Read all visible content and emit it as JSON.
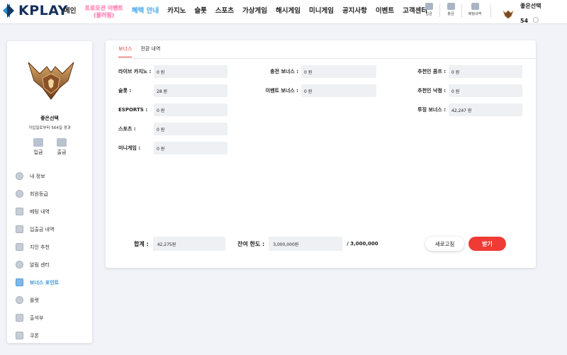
{
  "brand": {
    "name": "KPLAY"
  },
  "nav": {
    "items": [
      {
        "label": "메인",
        "style": "normal"
      },
      {
        "label": "프로모션 이벤트",
        "sub": "(블러됨)",
        "style": "pink"
      },
      {
        "label": "혜택 안내",
        "style": "blue"
      },
      {
        "label": "카지노",
        "style": "normal"
      },
      {
        "label": "슬롯",
        "style": "normal"
      },
      {
        "label": "스포츠",
        "style": "normal"
      },
      {
        "label": "가상게임",
        "style": "normal"
      },
      {
        "label": "해시게임",
        "style": "normal"
      },
      {
        "label": "미니게임",
        "style": "normal"
      },
      {
        "label": "공지사항",
        "style": "normal"
      },
      {
        "label": "이벤트",
        "style": "normal"
      },
      {
        "label": "고객센터",
        "style": "normal"
      }
    ],
    "quick": [
      {
        "label": "입금",
        "icon": "deposit-icon"
      },
      {
        "label": "출금",
        "icon": "withdraw-icon"
      },
      {
        "label": "배팅내역",
        "icon": "history-icon"
      }
    ]
  },
  "user": {
    "name": "좋은선택",
    "level": "54",
    "since": "가입일로부터 564일 경과",
    "deposit_label": "입금",
    "withdraw_label": "출금"
  },
  "sidebar": {
    "items": [
      {
        "label": "내 정보",
        "icon": "user-icon",
        "active": false
      },
      {
        "label": "회원등급",
        "icon": "grade-icon",
        "active": false
      },
      {
        "label": "베팅 내역",
        "icon": "betting-history-icon",
        "active": false
      },
      {
        "label": "입출금 내역",
        "icon": "transaction-icon",
        "active": false
      },
      {
        "label": "지인 추천",
        "icon": "referral-icon",
        "active": false
      },
      {
        "label": "알림 센터",
        "icon": "bell-icon",
        "active": false
      },
      {
        "label": "보너스 포인트",
        "icon": "bonus-icon",
        "active": true
      },
      {
        "label": "룰렛",
        "icon": "roulette-icon",
        "active": false
      },
      {
        "label": "출석부",
        "icon": "attendance-icon",
        "active": false
      },
      {
        "label": "쿠폰",
        "icon": "coupon-icon",
        "active": false
      }
    ]
  },
  "tabs": [
    {
      "label": "보너스",
      "active": true
    },
    {
      "label": "전환 내역",
      "active": false
    }
  ],
  "bonus": {
    "col1": [
      {
        "label": "라이브 카지노 :",
        "value": "0 원"
      },
      {
        "label": "슬롯 :",
        "value": "28 원"
      },
      {
        "label": "ESPORTS :",
        "value": "0 원"
      },
      {
        "label": "스포츠 :",
        "value": "0 원"
      },
      {
        "label": "미니게임 :",
        "value": "0 원"
      }
    ],
    "col2": [
      {
        "label": "충전 보너스 :",
        "value": "0 원"
      },
      {
        "label": "이벤트 보너스 :",
        "value": "0 원"
      }
    ],
    "col3": [
      {
        "label": "추천인 콤프 :",
        "value": "0 원"
      },
      {
        "label": "추천인 낙첨 :",
        "value": "0 원"
      },
      {
        "label": "루징 보너스 :",
        "value": "42,247 원"
      }
    ]
  },
  "summary": {
    "total_label": "합계 :",
    "total_value": "42,275원",
    "limit_label": "잔여 한도 :",
    "limit_value": "3,000,000원",
    "limit_max": "/ 3,000,000"
  },
  "buttons": {
    "refresh": "새로고침",
    "receive": "받기"
  }
}
